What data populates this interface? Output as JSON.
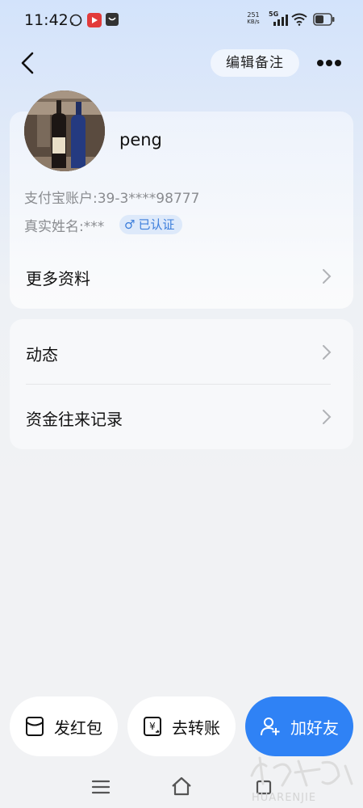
{
  "status_bar": {
    "time": "11:42",
    "net_speed_value": "251",
    "net_speed_unit": "KB/s",
    "network": "5G"
  },
  "nav": {
    "remark_label": "编辑备注"
  },
  "profile": {
    "username": "peng",
    "account": "支付宝账户:39-3****98777",
    "real_name": "真实姓名:***",
    "verified_label": "已认证",
    "gender_icon": "male-icon"
  },
  "menu": {
    "more_info": "更多资料",
    "moments": "动态",
    "fund_records": "资金往来记录"
  },
  "actions": {
    "red_packet": "发红包",
    "transfer": "去转账",
    "add_friend": "加好友"
  },
  "watermark": {
    "text": "HUARENJIE"
  },
  "colors": {
    "accent": "#2f82f5",
    "badge_bg": "#dde9fa",
    "badge_text": "#3b7ddb",
    "secondary_text": "#8a8c90"
  }
}
